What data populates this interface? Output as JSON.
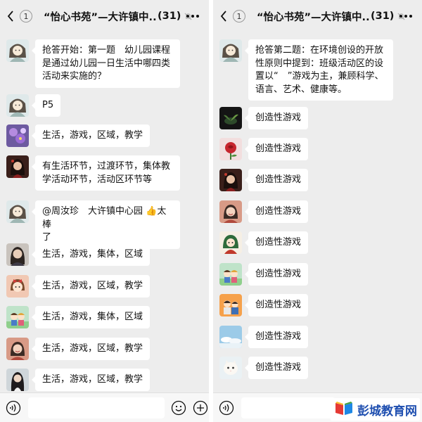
{
  "colors": {
    "chat_bg": "#ededed",
    "bubble_bg": "#ffffff",
    "text": "#111111",
    "watermark": "#1f4fb0"
  },
  "left": {
    "header": {
      "back_icon": "chevron-left-icon",
      "unread_badge": "1",
      "title": "“怡心书苑”—大许镇中...",
      "member_count": "(31)",
      "mute_icon": "mute-bell-icon",
      "more_icon": "more-icon"
    },
    "messages": [
      {
        "avatar": "avatar-girl-sketch",
        "lines": [
          "抢答开始：第一题　幼儿园课程",
          "是通过幼儿园一日生活中哪四类",
          "活动来实施的？"
        ]
      },
      {
        "avatar": "avatar-girl-sketch",
        "lines": [
          "P5"
        ]
      },
      {
        "avatar": "avatar-purple-flower",
        "lines": [
          "生活，游戏，区域，教学"
        ]
      },
      {
        "avatar": "avatar-dark-portrait",
        "lines": [
          "有生活环节，过渡环节，集体教",
          "学活动环节，活动区环节等"
        ]
      },
      {
        "avatar": "avatar-girl-sketch",
        "lines": [
          "@周汝珍　大许镇中心园 👍太棒",
          "了"
        ]
      },
      {
        "avatar": "avatar-woman-photo",
        "lines": [
          "生活，游戏，集体，区域"
        ]
      },
      {
        "avatar": "avatar-girl-bow",
        "lines": [
          "生活，游戏，区域，教学"
        ]
      },
      {
        "avatar": "avatar-kids-cartoon",
        "lines": [
          "生活，游戏，集体，区域"
        ]
      },
      {
        "avatar": "avatar-smiling-girl",
        "lines": [
          "生活，游戏，区域，教学"
        ]
      },
      {
        "avatar": "avatar-long-hair-girl",
        "lines": [
          "生活，游戏，区域，教学"
        ]
      }
    ],
    "footer": {
      "voice_icon": "voice-icon",
      "emoji_icon": "emoji-icon",
      "add_icon": "plus-icon"
    }
  },
  "right": {
    "header": {
      "back_icon": "chevron-left-icon",
      "unread_badge": "1",
      "title": "“怡心书苑”—大许镇中...",
      "member_count": "(31)",
      "mute_icon": "mute-bell-icon",
      "more_icon": "more-icon"
    },
    "messages": [
      {
        "avatar": "avatar-girl-sketch",
        "lines": [
          "抢答第二题：在环境创设的开放",
          "性原则中提到：班级活动区的设",
          "置以“　”游戏为主，兼顾科学、",
          "语言、艺术、健康等。"
        ]
      },
      {
        "avatar": "avatar-dark-plant",
        "lines": [
          "创造性游戏"
        ]
      },
      {
        "avatar": "avatar-red-rose",
        "lines": [
          "创造性游戏"
        ]
      },
      {
        "avatar": "avatar-dark-portrait",
        "lines": [
          "创造性游戏"
        ]
      },
      {
        "avatar": "avatar-smiling-girl",
        "lines": [
          "创造性游戏"
        ]
      },
      {
        "avatar": "avatar-green-hood",
        "lines": [
          "创造性游戏"
        ]
      },
      {
        "avatar": "avatar-kids-cartoon",
        "lines": [
          "创造性游戏"
        ]
      },
      {
        "avatar": "avatar-family-cartoon",
        "lines": [
          "创造性游戏"
        ]
      },
      {
        "avatar": "avatar-sky-clouds",
        "lines": [
          "创造性游戏"
        ]
      },
      {
        "avatar": "avatar-white-cat",
        "lines": [
          "创造性游戏"
        ]
      }
    ],
    "footer": {
      "voice_icon": "voice-icon",
      "emoji_icon": "emoji-icon",
      "add_icon": "plus-icon"
    }
  },
  "watermark": {
    "text": "彭城教育网",
    "logo_icon": "book-logo-icon"
  }
}
